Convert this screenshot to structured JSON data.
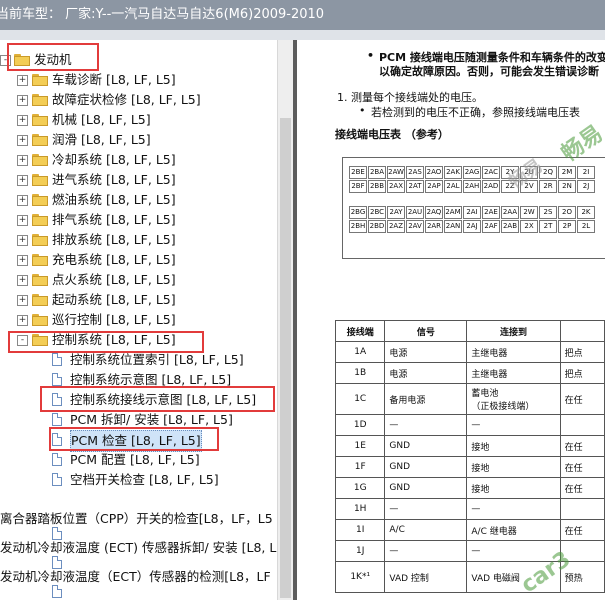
{
  "title": "当前车型：  厂家:Y--一汽马自达马自达6(M6)2009-2010",
  "tree": {
    "root": "发动机",
    "items": [
      {
        "label": "车载诊断 [L8, LF, L5]"
      },
      {
        "label": "故障症状检修 [L8, LF, L5]"
      },
      {
        "label": "机械 [L8, LF, L5]"
      },
      {
        "label": "润滑 [L8, LF, L5]"
      },
      {
        "label": "冷却系统 [L8, LF, L5]"
      },
      {
        "label": "进气系统 [L8, LF, L5]"
      },
      {
        "label": "燃油系统 [L8, LF, L5]"
      },
      {
        "label": "排气系统 [L8, LF, L5]"
      },
      {
        "label": "排放系统 [L8, LF, L5]"
      },
      {
        "label": "充电系统 [L8, LF, L5]"
      },
      {
        "label": "点火系统 [L8, LF, L5]"
      },
      {
        "label": "起动系统 [L8, LF, L5]"
      },
      {
        "label": "巡行控制 [L8, LF, L5]"
      },
      {
        "label": "控制系统 [L8, LF, L5]"
      }
    ],
    "sub_items": [
      {
        "label": "控制系统位置索引 [L8, LF, L5]"
      },
      {
        "label": "控制系统示意图 [L8, LF, L5]"
      },
      {
        "label": "控制系统接线示意图 [L8, LF, L5]"
      },
      {
        "label": "PCM 拆卸/ 安装 [L8, LF, L5]"
      },
      {
        "label": "PCM 检查 [L8, LF, L5]"
      },
      {
        "label": "PCM 配置 [L8, LF, L5]"
      },
      {
        "label": "空档开关检查 [L8, LF, L5]"
      }
    ],
    "tail_items": [
      {
        "label": "离合器踏板位置（CPP）开关的检查[L8，LF，L5"
      },
      {
        "label": "发动机冷却液温度 (ECT) 传感器拆卸/ 安装 [L8, L"
      },
      {
        "label": "发动机冷却液温度（ECT）传感器的检测[L8，LF"
      }
    ]
  },
  "doc": {
    "note1": "PCM 接线端电压随测量条件和车辆条件的改变",
    "note1b": "以确定故障原因。否则，可能会发生错误诊断",
    "step1": "1.  测量每个接线端处的电压。",
    "step1b": "若检测到的电压不正确，参照接线端电压表",
    "table_title": "接线端电压表 （参考）",
    "connector_rows": [
      [
        "2BE",
        "2BA",
        "2AW",
        "2AS",
        "2AO",
        "2AK",
        "2AG",
        "2AC",
        "2Y",
        "2U",
        "2Q",
        "2M",
        "2I"
      ],
      [
        "2BF",
        "2BB",
        "2AX",
        "2AT",
        "2AP",
        "2AL",
        "2AH",
        "2AD",
        "2Z",
        "2V",
        "2R",
        "2N",
        "2J"
      ],
      [
        "2BG",
        "2BC",
        "2AY",
        "2AU",
        "2AQ",
        "2AM",
        "2AI",
        "2AE",
        "2AA",
        "2W",
        "2S",
        "2O",
        "2K"
      ],
      [
        "2BH",
        "2BD",
        "2AZ",
        "2AV",
        "2AR",
        "2AN",
        "2AJ",
        "2AF",
        "2AB",
        "2X",
        "2T",
        "2P",
        "2L"
      ]
    ],
    "table_headers": [
      "接线端",
      "信号",
      "连接到",
      ""
    ],
    "table_rows": [
      [
        "1A",
        "电源",
        "主继电器",
        "把点"
      ],
      [
        "1B",
        "电源",
        "主继电器",
        "把点"
      ],
      [
        "1C",
        "备用电源",
        "蓄电池\n（正极接线端）",
        "在任"
      ],
      [
        "1D",
        "—",
        "—",
        ""
      ],
      [
        "1E",
        "GND",
        "接地",
        "在任"
      ],
      [
        "1F",
        "GND",
        "接地",
        "在任"
      ],
      [
        "1G",
        "GND",
        "接地",
        "在任"
      ],
      [
        "1H",
        "—",
        "—",
        ""
      ],
      [
        "1I",
        "A/C",
        "A/C 继电器",
        "在任"
      ],
      [
        "1J",
        "—",
        "—",
        ""
      ],
      [
        "1K*¹",
        "VAD 控制",
        "VAD 电磁阀",
        "预热"
      ]
    ],
    "watermarks": [
      "畅易",
      "畅易",
      "car3"
    ]
  },
  "colors": {
    "titlebar": "#8c96a3",
    "highlight": "#e23b3b",
    "selection": "#cfe3f8"
  }
}
